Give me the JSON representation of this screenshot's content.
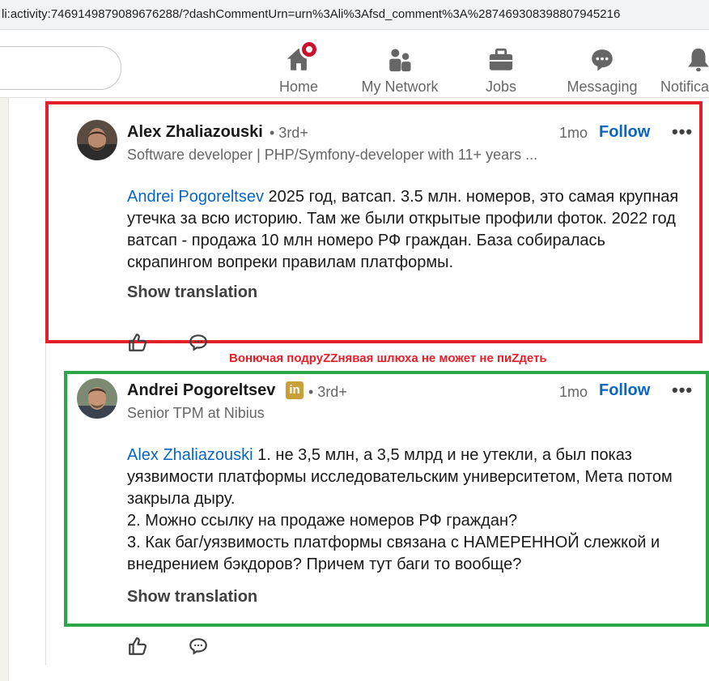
{
  "browser": {
    "url": "li:activity:7469149879089676288/?dashCommentUrn=urn%3Ali%3Afsd_comment%3A%287469308398807945216"
  },
  "nav": {
    "items": [
      {
        "label": "Home",
        "icon": "home-icon",
        "notification_dot": true
      },
      {
        "label": "My Network",
        "icon": "network-icon"
      },
      {
        "label": "Jobs",
        "icon": "briefcase-icon"
      },
      {
        "label": "Messaging",
        "icon": "messaging-icon"
      },
      {
        "label": "Notifica",
        "icon": "bell-icon"
      }
    ]
  },
  "comments": [
    {
      "author": "Alex Zhaliazouski",
      "degree": "• 3rd+",
      "headline": "Software developer | PHP/Symfony-developer with 11+ years ...",
      "time": "1mo",
      "follow_label": "Follow",
      "more_label": "•••",
      "mention": "Andrei Pogoreltsev",
      "text": " 2025 год, ватсап. 3.5 млн. номеров, это самая крупная утечка за всю историю. Там же были открытые профили фоток. 2022 год ватсап - продажа 10 млн номеро РФ граждан. База собиралась скрапингом вопреки правилам платформы.",
      "show_translation": "Show translation",
      "highlight_color": "#e3202a"
    },
    {
      "author": "Andrei Pogoreltsev",
      "badge": "in",
      "degree": "• 3rd+",
      "headline": "Senior TPM at Nibius",
      "time": "1mo",
      "follow_label": "Follow",
      "more_label": "•••",
      "mention": "Alex Zhaliazouski",
      "text_lines": [
        " 1. не 3,5 млн, а 3,5 млрд и не утекли, а был показ уязвимости платформы исследовательским университетом, Мета потом закрыла дыру.",
        "2. Можно ссылку на продаже номеров РФ граждан?",
        "3. Как баг/уязвимость платформы связана с НАМЕРЕННОЙ слежкой и внедрением бэкдоров? Причем тут баги то вообще?"
      ],
      "show_translation": "Show translation",
      "highlight_color": "#29a845"
    }
  ],
  "annotation": "Вонючая подруZZнявая шлюха не может не пиZдеть"
}
